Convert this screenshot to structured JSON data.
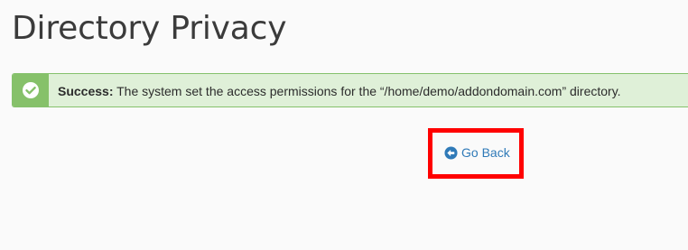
{
  "page": {
    "title": "Directory Privacy"
  },
  "alert": {
    "icon": "check-circle-icon",
    "label": "Success:",
    "message": " The system set the access permissions for the “/home/demo/addondomain.com” directory.",
    "colors": {
      "background": "#dff0d8",
      "border": "#85c16c",
      "icon_box": "#86c16a"
    }
  },
  "actions": {
    "go_back_label": "Go Back",
    "go_back_icon": "arrow-circle-left-icon",
    "link_color": "#2f7ab8",
    "highlight_color": "#ff0000"
  }
}
